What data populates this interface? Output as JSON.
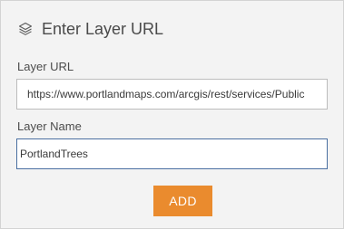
{
  "header": {
    "icon": "layers-icon",
    "title": "Enter Layer URL"
  },
  "layer_url": {
    "label": "Layer URL",
    "value": "https://www.portlandmaps.com/arcgis/rest/services/Public"
  },
  "layer_name": {
    "label": "Layer Name",
    "value": "PortlandTrees"
  },
  "actions": {
    "add_label": "ADD"
  },
  "colors": {
    "accent": "#ea8b2e",
    "panel_bg": "#f3f3f3",
    "focus_border": "#4a6fa1"
  }
}
